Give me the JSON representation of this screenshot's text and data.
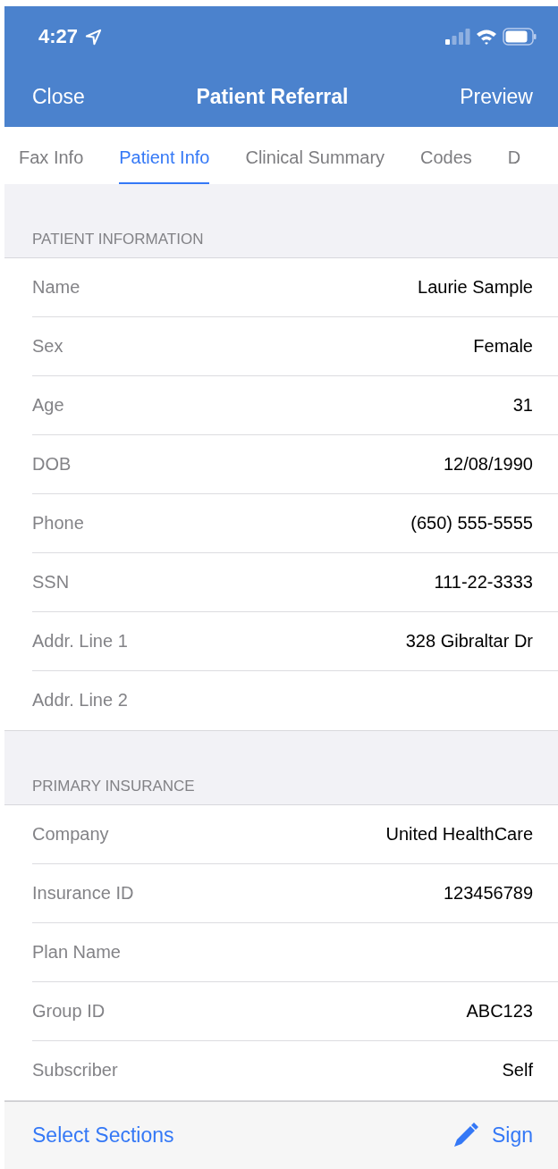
{
  "status_bar": {
    "time": "4:27"
  },
  "nav": {
    "left": "Close",
    "title": "Patient Referral",
    "right": "Preview"
  },
  "tabs": [
    {
      "label": "Fax Info",
      "selected": false
    },
    {
      "label": "Patient Info",
      "selected": true
    },
    {
      "label": "Clinical Summary",
      "selected": false
    },
    {
      "label": "Codes",
      "selected": false
    },
    {
      "label": "D",
      "selected": false
    }
  ],
  "sections": [
    {
      "header": "PATIENT INFORMATION",
      "rows": [
        {
          "label": "Name",
          "value": "Laurie Sample"
        },
        {
          "label": "Sex",
          "value": "Female"
        },
        {
          "label": "Age",
          "value": "31"
        },
        {
          "label": "DOB",
          "value": "12/08/1990"
        },
        {
          "label": "Phone",
          "value": "(650) 555-5555"
        },
        {
          "label": "SSN",
          "value": "111-22-3333"
        },
        {
          "label": "Addr. Line 1",
          "value": "328 Gibraltar Dr"
        },
        {
          "label": "Addr. Line 2"
        }
      ]
    },
    {
      "header": "PRIMARY INSURANCE",
      "rows": [
        {
          "label": "Company",
          "value": "United HealthCare"
        },
        {
          "label": "Insurance ID",
          "value": "123456789"
        },
        {
          "label": "Plan Name"
        },
        {
          "label": "Group ID",
          "value": "ABC123"
        },
        {
          "label": "Subscriber",
          "value": "Self"
        }
      ]
    }
  ],
  "toolbar": {
    "left": "Select Sections",
    "right": "Sign"
  }
}
